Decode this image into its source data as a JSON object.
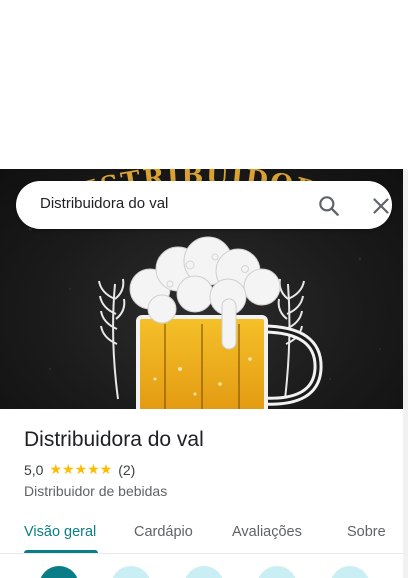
{
  "search": {
    "query": "Distribuidora do val"
  },
  "hero": {
    "logo_text": "DISTRIBUIDORA DO"
  },
  "place": {
    "name": "Distribuidora do val",
    "rating": "5,0",
    "stars": "★★★★★",
    "review_count": "(2)",
    "category": "Distribuidor de bebidas"
  },
  "tabs": [
    {
      "label": "Visão geral",
      "active": true
    },
    {
      "label": "Cardápio",
      "active": false
    },
    {
      "label": "Avaliações",
      "active": false
    },
    {
      "label": "Sobre",
      "active": false
    }
  ],
  "colors": {
    "accent": "#0b7d86",
    "star": "#fbbc04",
    "action_light": "#c9eef4"
  },
  "icons": {
    "search": "search-icon",
    "close": "close-icon"
  }
}
